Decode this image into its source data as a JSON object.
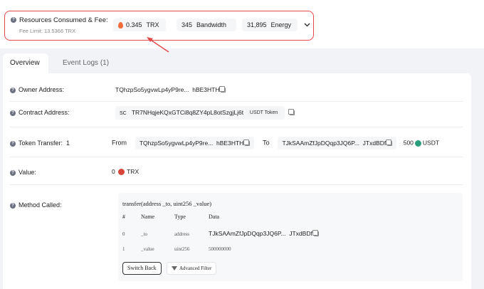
{
  "fee": {
    "title": "Resources Consumed & Fee:",
    "limit": "Fee Limit: 13.5366 TRX",
    "trx_value": "0.345",
    "trx_unit": "TRX",
    "bandwidth_value": "345",
    "bandwidth_unit": "Bandwidth",
    "energy_value": "31,895",
    "energy_unit": "Energy",
    "highlight_color": "#e24a4a"
  },
  "tabs": [
    {
      "label": "Overview",
      "active": true
    },
    {
      "label": "Event Logs (1)",
      "active": false
    }
  ],
  "owner": {
    "label": "Owner Address:",
    "address_start": "TQhzpSo5ygvwLp4yP9re...",
    "address_end": "hBE3HTH"
  },
  "contract": {
    "label": "Contract Address:",
    "badge": "SC",
    "address": "TR7NHqjeKQxGTCi8q8ZY4pL8otSzgjLj6t",
    "token_tag": "USDT Token"
  },
  "transfer": {
    "label": "Token Transfer:",
    "count": "1",
    "from_label": "From",
    "from_start": "TQhzpSo5ygvwLp4yP9re...",
    "from_end": "hBE3HTH",
    "to_label": "To",
    "to_start": "TJkSAAmZfJpDQqp3JQ6P...",
    "to_end": "JTxdBDf",
    "amount": "500",
    "token": "USDT"
  },
  "value": {
    "label": "Value:",
    "amount": "0",
    "unit": "TRX"
  },
  "method": {
    "label": "Method Called:",
    "signature": "transfer(address _to, uint256 _value)",
    "headers": [
      "#",
      "Name",
      "Type",
      "Data"
    ],
    "rows": [
      {
        "index": "0",
        "name": "_to",
        "type": "address",
        "data_start": "TJkSAAmZfJpDQqp3JQ6P...",
        "data_end": "JTxdBDf"
      },
      {
        "index": "1",
        "name": "_value",
        "type": "uint256",
        "data": "500000000"
      }
    ],
    "switch_button": "Switch Back",
    "filter_button": "Advanced Filter"
  },
  "icons": {
    "help": "question-circle-icon",
    "fire": "flame-icon",
    "expand": "chevron-down-icon",
    "copy": "copy-icon",
    "trx": "trx-coin-icon",
    "usdt": "usdt-coin-icon",
    "filter": "filter-icon"
  }
}
